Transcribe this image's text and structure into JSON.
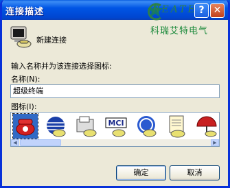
{
  "window": {
    "title": "连接描述",
    "help_glyph": "?",
    "close_glyph": "✕"
  },
  "logo": {
    "letters": "REATE",
    "name": "科瑞艾特电气"
  },
  "header": {
    "title": "新建连接"
  },
  "form": {
    "prompt": "输入名称并为该连接选择图标:",
    "name_label": "名称(N):",
    "name_value": "超级终端",
    "icon_label": "图标(I):"
  },
  "icons": [
    {
      "name": "red-phone-icon"
    },
    {
      "name": "globe-phone-icon"
    },
    {
      "name": "fax-phone-icon"
    },
    {
      "name": "mci-icon",
      "text": "MCI"
    },
    {
      "name": "ge-phone-icon"
    },
    {
      "name": "notepad-phone-icon"
    },
    {
      "name": "umbrella-phone-icon"
    }
  ],
  "buttons": {
    "ok": "确定",
    "cancel": "取消"
  },
  "colors": {
    "titlebar": "#0055e5",
    "selection": "#316ac5",
    "dialog": "#ece9d8"
  }
}
